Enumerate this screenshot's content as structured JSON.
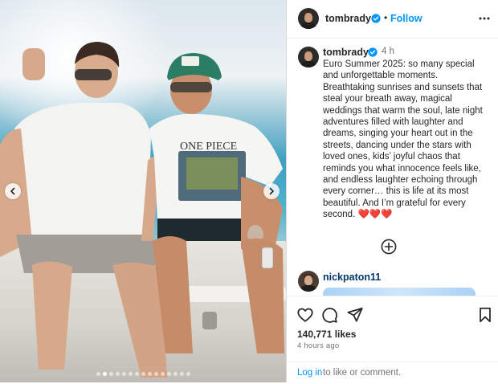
{
  "post": {
    "username": "tombrady",
    "follow_label": "Follow",
    "separator": "•",
    "time_ago_short": "4 h",
    "caption": "Euro Summer 2025: so many special and unforgettable moments. Breathtaking sunrises and sunsets that steal your breath away, magical weddings that warm the soul, late night adventures filled with laughter and dreams, singing your heart out in the streets, dancing under the stars with loved ones, kids’ joyful chaos that reminds you what innocence feels like, and endless laughter echoing through every corner… this is life at its most beautiful. And I’m grateful for every second. ❤️❤️❤️",
    "likes": "140,771 likes",
    "time_ago_long": "4 hours ago"
  },
  "carousel": {
    "count": 15,
    "active": 1
  },
  "comment": {
    "username": "nickpaton11"
  },
  "footer": {
    "login_label": "Log in",
    "login_rest": "to like or comment."
  },
  "colors": {
    "accent": "#0095f6",
    "verified": "#0095f6",
    "heart": "#ed1c24",
    "muted": "#737373"
  }
}
